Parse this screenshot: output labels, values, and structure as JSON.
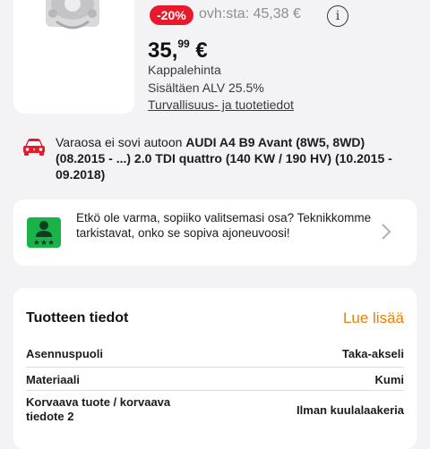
{
  "product": {
    "discount": "-20%",
    "old_price": "ovh:sta: 45,38 €",
    "price_main": "35,",
    "price_cents": "99",
    "price_currency": "€",
    "unit_label": "Kappalehinta",
    "vat_label": "Sisältäen ALV 25.5%",
    "safety_link": "Turvallisuus- ja tuotetiedot",
    "info_icon": "info-icon"
  },
  "compatibility": {
    "prefix": "Varaosa ei sovi autoon ",
    "vehicle": "AUDI A4 B9 Avant (8W5, 8WD) (08.2015 - ...) 2.0 TDI quattro (140 KW / 190 HV) (10.2015 - 09.2018)",
    "icon": "car-warning-icon",
    "accent": "#e8192c"
  },
  "expert": {
    "text": "Etkö ole varma, sopiiko valitsemasi osa? Teknikkomme tarkistavat, onko se sopiva ajoneuvoosi!",
    "icon": "expert-icon",
    "accent": "#19b34a"
  },
  "details": {
    "title": "Tuotteen tiedot",
    "read_more": "Lue lisää",
    "accent": "#ef7d00",
    "rows": [
      {
        "label": "Asennuspuoli",
        "value": "Taka-akseli"
      },
      {
        "label": "Materiaali",
        "value": "Kumi"
      },
      {
        "label": "Korvaava tuote / korvaava tiedote 2",
        "value": "Ilman kuulalaakeria"
      }
    ]
  }
}
